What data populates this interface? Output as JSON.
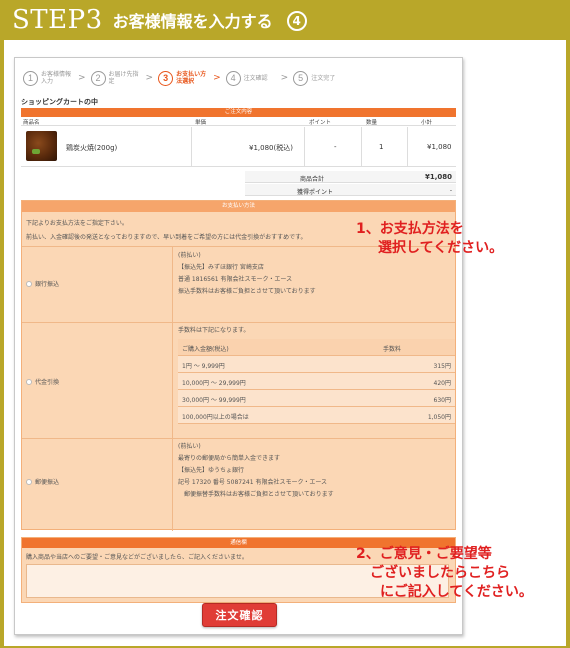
{
  "header": {
    "step": "STEP3",
    "title": "お客様情報を入力する",
    "step_circle": "4"
  },
  "progress": [
    {
      "num": "1",
      "label": "お客様情報入力",
      "active": false
    },
    {
      "num": "2",
      "label": "お届け先指定",
      "active": false
    },
    {
      "num": "3",
      "label": "お支払い方法選択",
      "active": true
    },
    {
      "num": "4",
      "label": "注文確認",
      "active": false
    },
    {
      "num": "5",
      "label": "注文完了",
      "active": false
    }
  ],
  "cart": {
    "title": "ショッピングカートの中",
    "band": "ご注文内容",
    "headers": {
      "product": "商品名",
      "price": "単価",
      "point": "ポイント",
      "qty": "数量",
      "subtotal": "小計"
    },
    "item": {
      "name": "鶏炭火焼(200g)",
      "price": "¥1,080(税込)",
      "point": "-",
      "qty": "1",
      "subtotal": "¥1,080"
    },
    "total_label": "商品合計",
    "total_value": "¥1,080",
    "points_label": "獲得ポイント",
    "points_value": "-"
  },
  "payment": {
    "band": "お支払い方法",
    "note1": "下記よりお支払方法をご指定下さい。",
    "note2": "前払い、入金確認後の発送となっておりますので、早い到着をご希望の方には代金引換がおすすめです。",
    "bank": {
      "name": "銀行振込",
      "lines": [
        "(前払い)",
        "【振込先】みずほ銀行 宮崎支店",
        "普通 1816561 有限会社スモーク・エース",
        "振込手数料はお客様ご負担とさせて頂いております"
      ]
    },
    "cod": {
      "name": "代金引換",
      "intro": "手数料は下記になります。",
      "col_amount": "ご購入金額(税込)",
      "col_fee": "手数料",
      "rows": [
        {
          "range": "1円 ～ 9,999円",
          "fee": "315円"
        },
        {
          "range": "10,000円 ～ 29,999円",
          "fee": "420円"
        },
        {
          "range": "30,000円 ～ 99,999円",
          "fee": "630円"
        },
        {
          "range": "100,000円以上の場合は",
          "fee": "1,050円"
        }
      ]
    },
    "postal": {
      "name": "郵便振込",
      "lines": [
        "(前払い)",
        "最寄りの郵便局から簡単入金できます",
        "【振込先】ゆうちょ銀行",
        "記号 17320 番号 5087241 有限会社スモーク・エース",
        "郵便振替手数料はお客様ご負担とさせて頂いております"
      ]
    }
  },
  "comment": {
    "band": "通信欄",
    "note": "購入商品や当店へのご要望・ご意見などがございましたら、ご記入くださいませ。",
    "value": ""
  },
  "confirm_button": "注文確認",
  "callouts": {
    "pay_line1": "1、お支払方法を",
    "pay_line2": "選択してください。",
    "comm_line1": "2、ご意見・ご要望等",
    "comm_line2": "ございましたらこちら",
    "comm_line3": "にご記入してください。"
  }
}
